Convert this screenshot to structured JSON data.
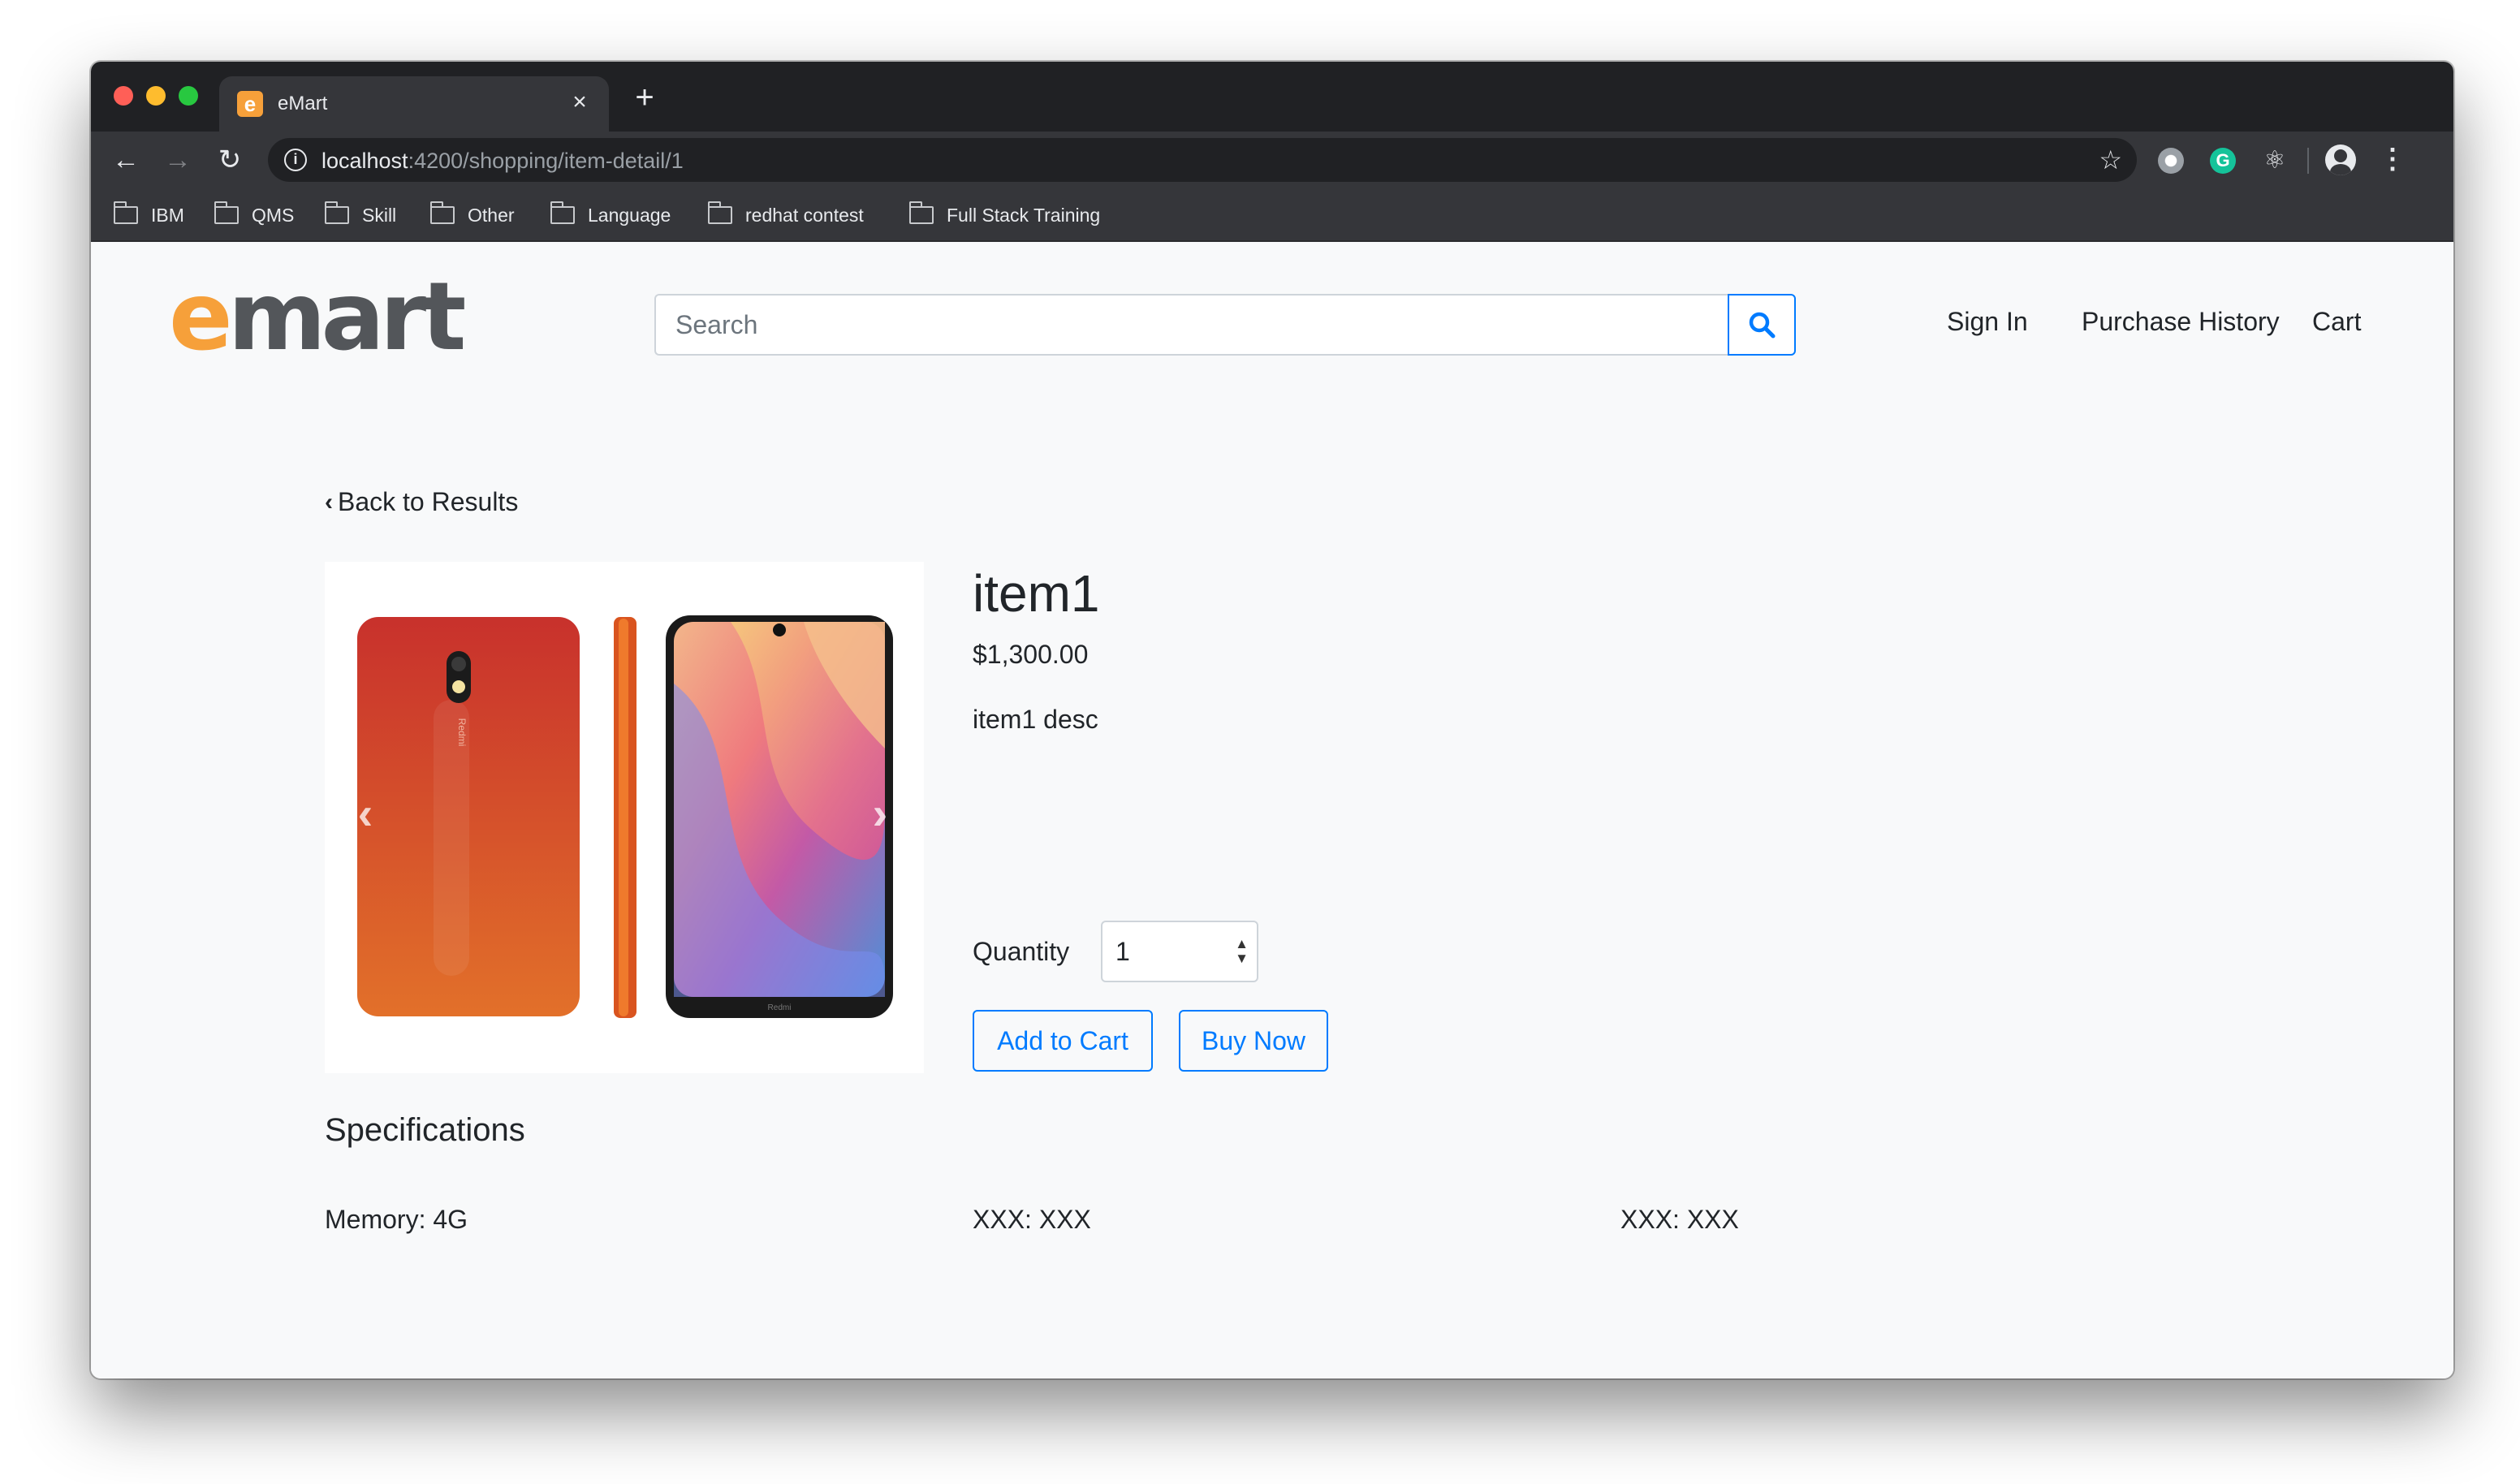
{
  "browser": {
    "tab_title": "eMart",
    "tab_favicon_letter": "e",
    "new_tab_label": "+",
    "url_host": "localhost",
    "url_path": ":4200/shopping/item-detail/1",
    "bookmarks": [
      "IBM",
      "QMS",
      "Skill",
      "Other",
      "Language",
      "redhat contest",
      "Full Stack Training"
    ]
  },
  "header": {
    "logo_e": "e",
    "logo_rest": "mart",
    "search_placeholder": "Search",
    "nav": {
      "sign_in": "Sign In",
      "purchase_history": "Purchase History",
      "cart": "Cart"
    }
  },
  "product": {
    "back_label": "Back to Results",
    "name": "item1",
    "price": "$1,300.00",
    "description": "item1 desc",
    "quantity_label": "Quantity",
    "quantity_value": "1",
    "add_to_cart_label": "Add to Cart",
    "buy_now_label": "Buy Now",
    "image_brand_text": "Redmi"
  },
  "specifications": {
    "heading": "Specifications",
    "items": [
      "Memory: 4G",
      "XXX: XXX",
      "XXX: XXX"
    ]
  },
  "colors": {
    "primary": "#007bff",
    "brand_orange": "#f6a03a",
    "brand_gray": "#53565a",
    "page_bg": "#f8f9fa"
  },
  "icons": {
    "search": "search-icon",
    "back": "chevron-left-icon",
    "carousel_prev": "chevron-left-icon",
    "carousel_next": "chevron-right-icon"
  }
}
